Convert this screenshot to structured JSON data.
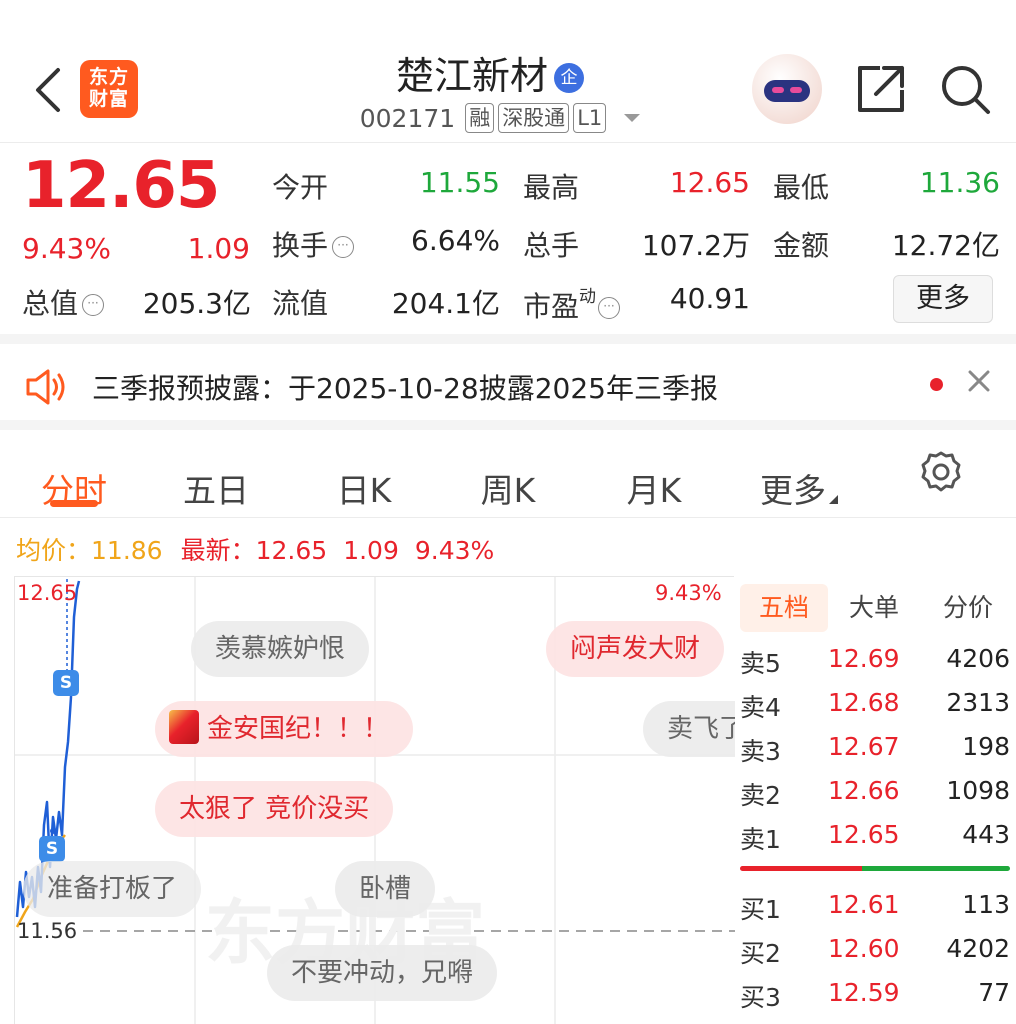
{
  "header": {
    "logo_text": "东方财富",
    "stock_name": "楚江新材",
    "badge": "企",
    "code": "002171",
    "tags": [
      "融",
      "深股通",
      "L1"
    ]
  },
  "quote": {
    "price": "12.65",
    "change_pct": "9.43%",
    "change_amt": "1.09",
    "rows": [
      [
        {
          "label": "今开",
          "value": "11.55",
          "color": "green"
        },
        {
          "label": "最高",
          "value": "12.65",
          "color": "red"
        },
        {
          "label": "最低",
          "value": "11.36",
          "color": "green"
        }
      ],
      [
        {
          "label": "换手",
          "value": "6.64%",
          "color": "black",
          "info": true
        },
        {
          "label": "总手",
          "value": "107.2万",
          "color": "black"
        },
        {
          "label": "金额",
          "value": "12.72亿",
          "color": "black"
        }
      ]
    ],
    "total_value_label": "总值",
    "total_value": "205.3亿",
    "float_value_label": "流值",
    "float_value": "204.1亿",
    "pe_label": "市盈",
    "pe_sup": "动",
    "pe_value": "40.91",
    "more_label": "更多"
  },
  "notice": {
    "text": "三季报预披露：于2025-10-28披露2025年三季报"
  },
  "tabs": [
    "分时",
    "五日",
    "日K",
    "周K",
    "月K",
    "更多"
  ],
  "active_tab": "分时",
  "price_line": {
    "avg_label": "均价：",
    "avg_value": "11.86",
    "latest_label": "最新：",
    "latest_value": "12.65",
    "change_amt": "1.09",
    "change_pct": "9.43%"
  },
  "chart": {
    "top_price": "12.65",
    "top_pct": "9.43%",
    "base_price": "11.56",
    "watermark": "东方财富",
    "s_marker": "S"
  },
  "barrages": [
    {
      "text": "羡慕嫉妒恨",
      "style": "gray"
    },
    {
      "text": "闷声发大财",
      "style": "pink"
    },
    {
      "text": "金安国纪！！！",
      "style": "pink",
      "icon": true
    },
    {
      "text": "卖飞了",
      "style": "gray"
    },
    {
      "text": "太狠了 竞价没买",
      "style": "pink"
    },
    {
      "text": "准备打板了",
      "style": "gray"
    },
    {
      "text": "卧槽",
      "style": "gray"
    },
    {
      "text": "不要冲动，兄嘚",
      "style": "gray"
    }
  ],
  "order_book": {
    "tabs": [
      "五档",
      "大单",
      "分价"
    ],
    "sells": [
      {
        "label": "卖5",
        "price": "12.69",
        "volume": "4206"
      },
      {
        "label": "卖4",
        "price": "12.68",
        "volume": "2313"
      },
      {
        "label": "卖3",
        "price": "12.67",
        "volume": "198"
      },
      {
        "label": "卖2",
        "price": "12.66",
        "volume": "1098"
      },
      {
        "label": "卖1",
        "price": "12.65",
        "volume": "443"
      }
    ],
    "buys": [
      {
        "label": "买1",
        "price": "12.61",
        "volume": "113"
      },
      {
        "label": "买2",
        "price": "12.60",
        "volume": "4202"
      },
      {
        "label": "买3",
        "price": "12.59",
        "volume": "77"
      }
    ]
  },
  "colors": {
    "up": "#e8222b",
    "down": "#1ea83b",
    "accent": "#ff5a1f",
    "avg_line": "#f0a51a",
    "price_line": "#1f5fd6"
  }
}
